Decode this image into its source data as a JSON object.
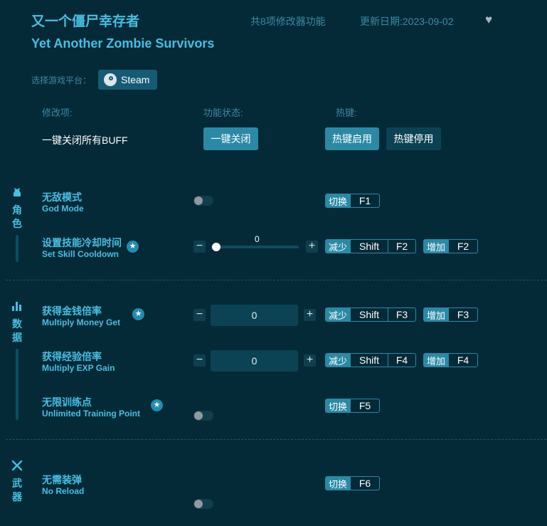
{
  "header": {
    "title_cn": "又一个僵尸幸存者",
    "title_en": "Yet Another Zombie Survivors",
    "feature_count": "共8项修改器功能",
    "update_date": "更新日期:2023-09-02",
    "favorite_icon": "heart-icon"
  },
  "platform": {
    "label": "选择游戏平台：",
    "steam_label": "Steam",
    "steam_icon": "steam-icon"
  },
  "columns": {
    "mod": "修改项:",
    "state": "功能状态:",
    "hotkey": "热键:"
  },
  "global": {
    "label": "一键关闭所有BUFF",
    "close_all": "一键关闭",
    "hotkey_enable": "热键启用",
    "hotkey_disable": "热键停用"
  },
  "categories": [
    {
      "name": "角色",
      "icon": "character-icon"
    },
    {
      "name": "数据",
      "icon": "stats-icon"
    },
    {
      "name": "武器",
      "icon": "weapon-icon"
    }
  ],
  "options": {
    "god_mode": {
      "cn": "无敌模式",
      "en": "God Mode",
      "enabled": false,
      "hotkey": {
        "action": "切换",
        "keys": [
          "F1"
        ]
      }
    },
    "skill_cooldown": {
      "cn": "设置技能冷却时间",
      "en": "Set Skill Cooldown",
      "starred": true,
      "value": "0",
      "slider_fraction": 0,
      "hotkey_dec": {
        "action": "减少",
        "keys": [
          "Shift",
          "F2"
        ]
      },
      "hotkey_inc": {
        "action": "增加",
        "keys": [
          "F2"
        ]
      }
    },
    "money_rate": {
      "cn": "获得金钱倍率",
      "en": "Multiply Money Get",
      "starred": true,
      "value": "0",
      "hotkey_dec": {
        "action": "减少",
        "keys": [
          "Shift",
          "F3"
        ]
      },
      "hotkey_inc": {
        "action": "增加",
        "keys": [
          "F3"
        ]
      }
    },
    "exp_rate": {
      "cn": "获得经验倍率",
      "en": "Multiply EXP Gain",
      "value": "0",
      "hotkey_dec": {
        "action": "减少",
        "keys": [
          "Shift",
          "F4"
        ]
      },
      "hotkey_inc": {
        "action": "增加",
        "keys": [
          "F4"
        ]
      }
    },
    "training_point": {
      "cn": "无限训练点",
      "en": "Unlimited Training Point",
      "starred": true,
      "enabled": false,
      "hotkey": {
        "action": "切换",
        "keys": [
          "F5"
        ]
      }
    },
    "no_reload": {
      "cn": "无需装弹",
      "en": "No Reload",
      "enabled": false,
      "hotkey": {
        "action": "切换",
        "keys": [
          "F6"
        ]
      }
    }
  },
  "glyphs": {
    "minus": "−",
    "plus": "+",
    "star": "★",
    "heart": "♥"
  },
  "colors": {
    "background": "#042a37",
    "accent": "#47bfe3",
    "button": "#2a8aa6",
    "button_dark": "#0b4354"
  }
}
